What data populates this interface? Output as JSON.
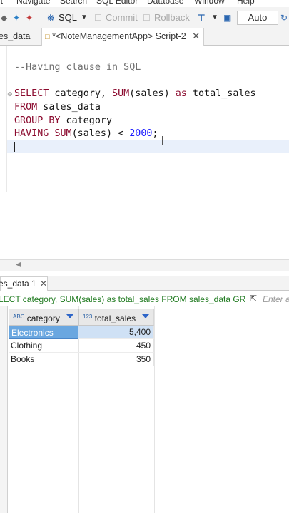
{
  "menu": {
    "edit": "it",
    "navigate": "Navigate",
    "search": "Search",
    "sql_editor": "SQL Editor",
    "database": "Database",
    "window": "Window",
    "help": "Help"
  },
  "toolbar": {
    "sql_label": "SQL",
    "commit_label": "Commit",
    "rollback_label": "Rollback",
    "transaction_mode": "Auto"
  },
  "editor_tabs": [
    {
      "label": "es_data"
    },
    {
      "label": "*<NoteManagementApp> Script-2"
    }
  ],
  "editor": {
    "comment": "--Having clause in SQL",
    "line1": {
      "kw1": "SELECT",
      "t1": " category, ",
      "kw2": "SUM",
      "t2": "(sales) ",
      "kw3": "as",
      "t3": " total_sales"
    },
    "line2": {
      "kw": "FROM",
      "t": " sales_data"
    },
    "line3": {
      "kw": "GROUP BY",
      "t": " category"
    },
    "line4": {
      "kw1": "HAVING",
      "t1": " ",
      "kw2": "SUM",
      "t2": "(sales) < ",
      "num": "2000",
      "t3": ";"
    }
  },
  "results": {
    "tab_label": "es_data 1",
    "query_text": "LECT category, SUM(sales) as total_sales FROM sales_data GROUP",
    "filter_placeholder": "Enter a",
    "columns": [
      {
        "type_tag": "ABC",
        "name": "category"
      },
      {
        "type_tag": "123",
        "name": "total_sales"
      }
    ],
    "rows": [
      {
        "category": "Electronics",
        "total_sales": "5,400"
      },
      {
        "category": "Clothing",
        "total_sales": "450"
      },
      {
        "category": "Books",
        "total_sales": "350"
      }
    ]
  },
  "colors": {
    "keyword": "#8b0a2e",
    "number": "#1c1cff",
    "query_text": "#1f7a1f",
    "selection": "#6aa7e0"
  }
}
